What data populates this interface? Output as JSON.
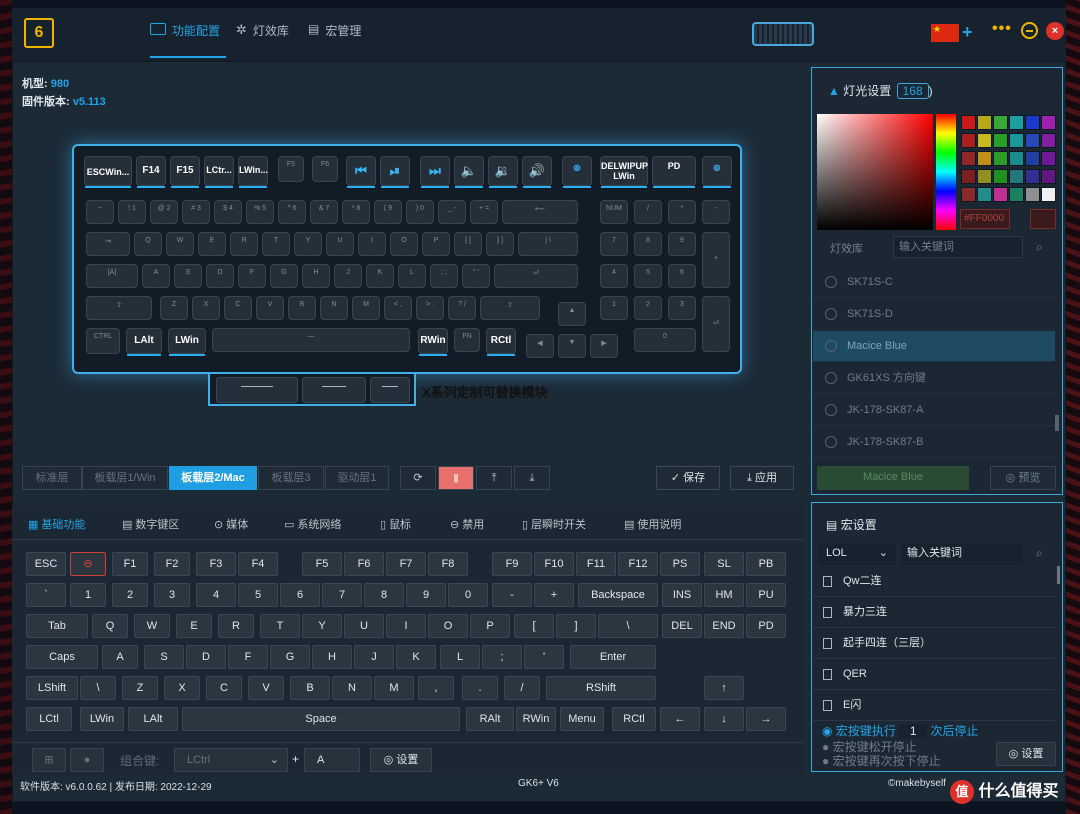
{
  "nav": {
    "tabs": [
      {
        "label": "功能配置",
        "active": true
      },
      {
        "label": "灯效库",
        "active": false
      },
      {
        "label": "宏管理",
        "active": false
      }
    ],
    "logo": "6"
  },
  "device": {
    "model_label": "机型: ",
    "model_value": "980",
    "firmware_label": "固件版本: ",
    "firmware_value": "v5.113"
  },
  "keyboard": {
    "module_label": "X系列定制可替换模块",
    "fn_row": [
      "ESCWin...",
      "F14",
      "F15",
      "LCtr...",
      "LWin...",
      "DELWIPUP",
      "LWin",
      "PD"
    ],
    "lit_keys": {
      "lalt": "LAlt",
      "lwin": "LWin",
      "rwin": "RWin",
      "rctl": "RCtl"
    }
  },
  "layers": {
    "tabs": [
      {
        "label": "标准层",
        "active": false
      },
      {
        "label": "板载层1/Win",
        "active": false
      },
      {
        "label": "板载层2/Mac",
        "active": true
      },
      {
        "label": "板载层3",
        "active": false
      },
      {
        "label": "驱动层1",
        "active": false
      }
    ],
    "save_label": "保存",
    "apply_label": "应用"
  },
  "lighting": {
    "title": "灯光设置",
    "count": "168",
    "hex": "#FF0000",
    "swatches": [
      "#cc1a1a",
      "#b8a81c",
      "#38a838",
      "#1aa0a0",
      "#1a3acc",
      "#a020b0",
      "#aa2020",
      "#c8b820",
      "#28a028",
      "#189898",
      "#2848b8",
      "#8020a0",
      "#902828",
      "#c09018",
      "#2c9c2c",
      "#1a8c8c",
      "#2040a0",
      "#701898",
      "#7a2020",
      "#909020",
      "#209020",
      "#207878",
      "#303090",
      "#601880",
      "#8a2a2a",
      "#208c8c",
      "#c03090",
      "#1a8060",
      "#909090",
      "#f0f0f0"
    ],
    "tab_effects": "灯效库",
    "search_placeholder": "输入关键词",
    "effects": [
      "SK71S-C",
      "SK71S-D",
      "Macice Blue",
      "GK61XS 方向键",
      "JK-178-SK87-A",
      "JK-178-SK87-B"
    ],
    "selected": "Macice Blue",
    "current_effect": "Macice Blue",
    "preview_label": "预览"
  },
  "macro": {
    "title": "宏设置",
    "category": "LOL",
    "search_placeholder": "输入关键词",
    "items": [
      "Qw二连",
      "暴力三连",
      "起手四连（三层）",
      "QER",
      "E闪"
    ],
    "options": [
      "宏按键执行",
      "次后停止",
      "宏按键松开停止",
      "宏按键再次按下停止"
    ],
    "repeat_count": "1",
    "settings_label": "设置"
  },
  "function_tabs": [
    {
      "label": "基础功能",
      "active": true
    },
    {
      "label": "数字键区",
      "active": false
    },
    {
      "label": "媒体",
      "active": false
    },
    {
      "label": "系统网络",
      "active": false
    },
    {
      "label": "鼠标",
      "active": false
    },
    {
      "label": "禁用",
      "active": false
    },
    {
      "label": "层瞬时开关",
      "active": false
    },
    {
      "label": "使用说明",
      "active": false
    }
  ],
  "keys": {
    "row1": [
      "ESC",
      "⊖",
      "F1",
      "F2",
      "F3",
      "F4",
      "F5",
      "F6",
      "F7",
      "F8",
      "F9",
      "F10",
      "F11",
      "F12",
      "PS",
      "SL",
      "PB"
    ],
    "row2": [
      "`",
      "1",
      "2",
      "3",
      "4",
      "5",
      "6",
      "7",
      "8",
      "9",
      "0",
      "-",
      "+",
      "Backspace",
      "INS",
      "HM",
      "PU"
    ],
    "row3": [
      "Tab",
      "Q",
      "W",
      "E",
      "R",
      "T",
      "Y",
      "U",
      "I",
      "O",
      "P",
      "[",
      "]",
      "\\",
      "DEL",
      "END",
      "PD"
    ],
    "row4": [
      "Caps",
      "A",
      "S",
      "D",
      "F",
      "G",
      "H",
      "J",
      "K",
      "L",
      ";",
      "'",
      "Enter"
    ],
    "row5": [
      "LShift",
      "\\",
      "Z",
      "X",
      "C",
      "V",
      "B",
      "N",
      "M",
      ",",
      ".",
      "/",
      "RShift",
      "↑"
    ],
    "row6": [
      "LCtl",
      "LWin",
      "LAlt",
      "Space",
      "RAlt",
      "RWin",
      "Menu",
      "RCtl",
      "←",
      "↓",
      "→"
    ]
  },
  "combo": {
    "label": "组合键:",
    "modifier": "LCtrl",
    "key": "A",
    "settings_label": "设置"
  },
  "footer": {
    "version": "软件版本: v6.0.0.62 | 发布日期: 2022-12-29",
    "product": "GK6+ V6",
    "site": "©makebyself",
    "watermark": "什么值得买"
  },
  "colors": {
    "accent": "#22a5e8",
    "brand": "#f0b400",
    "danger": "#e0302a"
  }
}
